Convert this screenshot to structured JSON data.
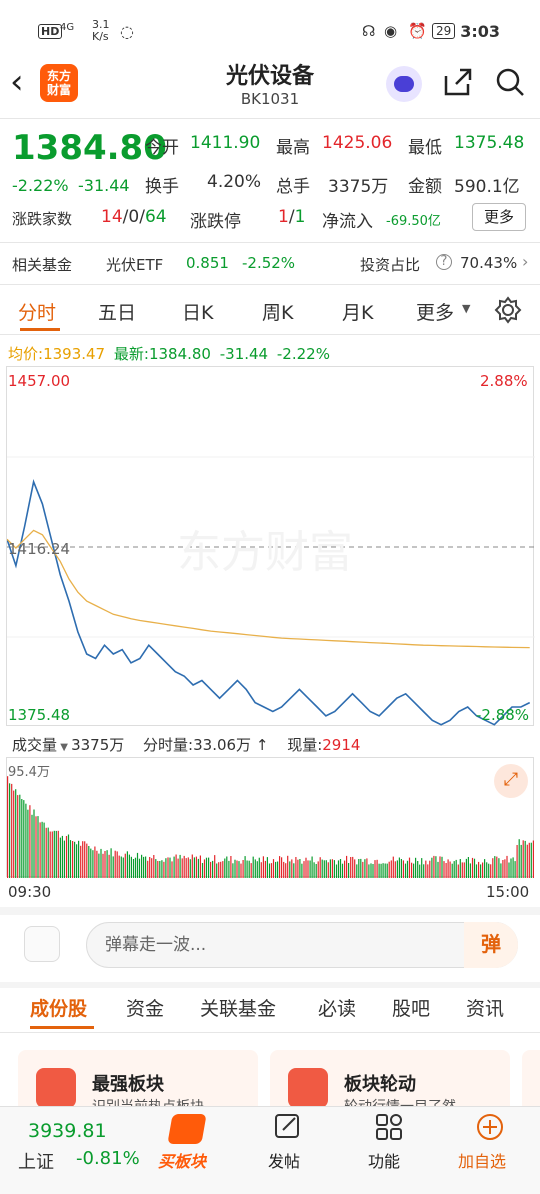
{
  "status_bar": {
    "network": "4G",
    "speed": "3.1\nK/s",
    "battery": "29",
    "time": "3:03"
  },
  "header": {
    "title": "光伏设备",
    "code": "BK1031",
    "logo_text": "东方\n财富"
  },
  "quote": {
    "price": "1384.80",
    "change_pct": "-2.22%",
    "change": "-31.44",
    "open_label": "今开",
    "open": "1411.90",
    "high_label": "最高",
    "high": "1425.06",
    "low_label": "最低",
    "low": "1375.48",
    "turnover_label": "换手",
    "turnover": "4.20%",
    "volume_label": "总手",
    "volume": "3375万",
    "amount_label": "金额",
    "amount": "590.1亿",
    "updown_label": "涨跌家数",
    "up": "14",
    "flat": "0",
    "down": "64",
    "slash": "/",
    "limit_label": "涨跌停",
    "limit_up": "1",
    "limit_down": "1",
    "netflow_label": "净流入",
    "netflow": "-69.50亿",
    "more_button": "更多"
  },
  "fund_row": {
    "label": "相关基金",
    "fund_name": "光伏ETF",
    "fund_price": "0.851",
    "fund_change": "-2.52%",
    "ratio_label": "投资占比",
    "ratio": "70.43%"
  },
  "chart_tabs": [
    "分时",
    "五日",
    "日K",
    "周K",
    "月K",
    "更多"
  ],
  "chart_info": {
    "avg_label": "均价:",
    "avg": "1393.47",
    "last_label": "最新:",
    "last": "1384.80",
    "change": "-31.44",
    "pct": "-2.22%"
  },
  "chart_data": {
    "type": "line",
    "ylim": [
      1375.48,
      1457.0
    ],
    "y_labels_left": [
      "1457.00",
      "1416.24",
      "1375.48"
    ],
    "y_labels_right": [
      "2.88%",
      "-2.88%"
    ],
    "x_labels": [
      "09:30",
      "15:00"
    ],
    "series": [
      {
        "name": "",
        "color": "#2e6db0",
        "values": [
          1418,
          1412,
          1421,
          1431,
          1426,
          1418,
          1410,
          1404,
          1397,
          1392,
          1391,
          1394,
          1392,
          1393,
          1390,
          1391,
          1394,
          1392,
          1390,
          1388,
          1387,
          1385,
          1386,
          1384,
          1382,
          1384,
          1386,
          1384,
          1381,
          1380,
          1379,
          1380,
          1382,
          1384,
          1382,
          1380,
          1378,
          1379,
          1381,
          1383,
          1381,
          1379,
          1378,
          1380,
          1382,
          1383,
          1381,
          1379,
          1377,
          1376,
          1377,
          1379,
          1380,
          1378,
          1377,
          1376,
          1378,
          1380,
          1380,
          1381
        ]
      },
      {
        "name": "均价",
        "color": "#e8b04a",
        "values": [
          1418,
          1416,
          1418,
          1420,
          1419,
          1416,
          1413,
          1409,
          1406,
          1404,
          1403,
          1402,
          1401,
          1400.5,
          1400,
          1399.6,
          1399.3,
          1399,
          1398.7,
          1398.4,
          1398.1,
          1397.8,
          1397.5,
          1397.2,
          1397,
          1396.8,
          1396.6,
          1396.4,
          1396.2,
          1396,
          1395.8,
          1395.6,
          1395.5,
          1395.4,
          1395.3,
          1395.2,
          1395.1,
          1395,
          1394.9,
          1394.8,
          1394.7,
          1394.6,
          1394.5,
          1394.4,
          1394.3,
          1394.2,
          1394.1,
          1394,
          1393.95,
          1393.9,
          1393.85,
          1393.8,
          1393.75,
          1393.7,
          1393.65,
          1393.6,
          1393.55,
          1393.5,
          1393.48,
          1393.47
        ]
      }
    ],
    "volume": {
      "max_label": "95.4万",
      "header": {
        "label": "成交量",
        "total": "3375万",
        "period_label": "分时量:",
        "period": "33.06万",
        "now_label": "现量:",
        "now": "2914"
      }
    }
  },
  "input": {
    "placeholder": "弹幕走一波...",
    "button": "弹"
  },
  "section_tabs": [
    "成份股",
    "资金",
    "关联基金",
    "必读",
    "股吧",
    "资讯"
  ],
  "cards": [
    {
      "title": "最强板块",
      "subtitle": "识别当前热点板块"
    },
    {
      "title": "板块轮动",
      "subtitle": "轮动行情一目了然"
    }
  ],
  "bottom_bar": {
    "index_value": "3939.81",
    "index_name": "上证",
    "index_change": "-0.81%",
    "items": [
      "买板块",
      "发帖",
      "功能",
      "加自选"
    ]
  }
}
